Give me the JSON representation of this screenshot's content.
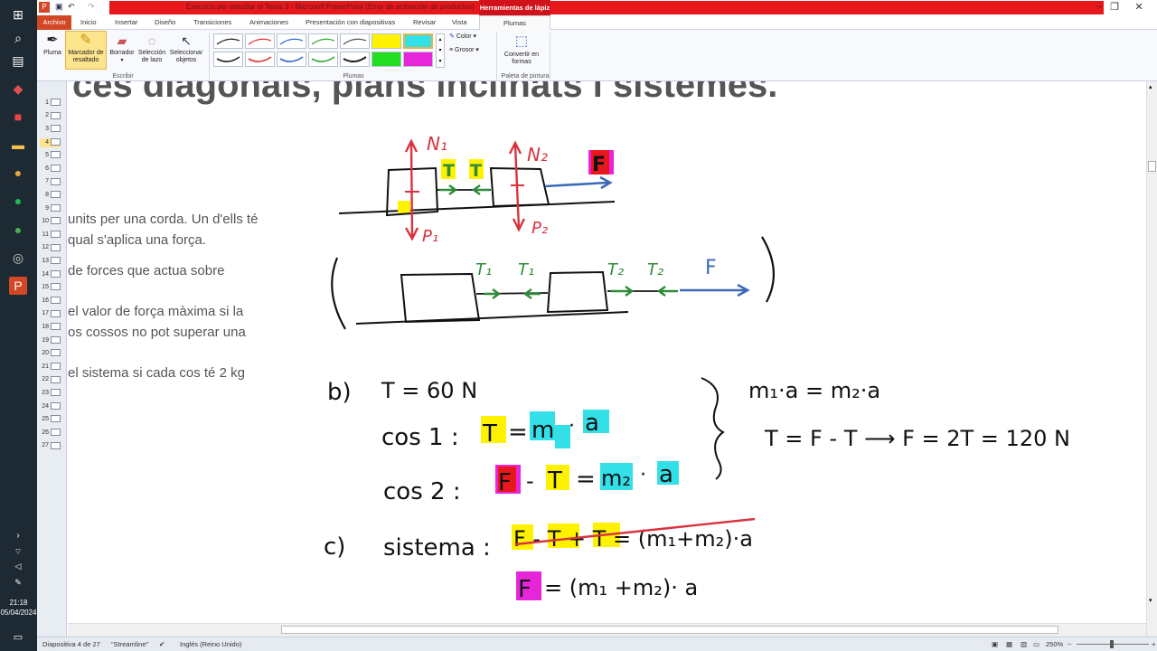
{
  "window": {
    "title": "Exercicis per estudiar el Tema 3 - Microsoft PowerPoint (Error de activación de productos)",
    "context_tab": "Herramientas de lápiz"
  },
  "tabs": [
    "Archivo",
    "Inicio",
    "Insertar",
    "Diseño",
    "Transiciones",
    "Animaciones",
    "Presentación con diapositivas",
    "Revisar",
    "Vista",
    "Plumas"
  ],
  "ribbon": {
    "write_group": "Escribir",
    "pens_group": "Plumas",
    "palette_group": "Paleta de pintura",
    "pen": "Pluma",
    "highlighter": "Marcador de resaltado",
    "eraser": "Borrador",
    "lasso": "Selección de lazo",
    "select_objects": "Seleccionar objetos",
    "color": "Color",
    "weight": "Grosor",
    "convert": "Convertir en formas"
  },
  "thumbs": [
    "1",
    "2",
    "3",
    "4",
    "5",
    "6",
    "7",
    "8",
    "9",
    "10",
    "11",
    "12",
    "13",
    "14",
    "15",
    "16",
    "17",
    "18",
    "19",
    "20",
    "21",
    "22",
    "23",
    "24",
    "25",
    "26",
    "27"
  ],
  "slide": {
    "heading": "ces diagonals, plans inclinats i sistemes.",
    "lines": [
      "units per una corda. Un d'ells té",
      "qual s'aplica una força.",
      "de  forces  que  actua  sobre",
      "el valor de força màxima si la",
      "os cossos no pot superar una",
      "el sistema si cada cos té 2 kg"
    ],
    "ink_text": {
      "n1": "N₁",
      "n2": "N₂",
      "p1": "P₁",
      "p2": "P₂",
      "t": "T",
      "f": "F",
      "t1": "T₁",
      "t2": "T₂",
      "b": "b)",
      "c": "c)",
      "eq1": "T = 60 N",
      "cos1": "cos 1 :",
      "cos2": "cos 2 :",
      "eq_cos1_t": "T",
      "eq_cos1_m": "m",
      "eq_cos1_a": "a",
      "eq_cos2_f": "F",
      "eq_cos2_t": "T",
      "eq_cos2_m": "m₂",
      "eq_cos2_a": "a",
      "right1": "m₁·a = m₂·a",
      "right2": "T = F - T  ⟶  F = 2T = 120 N",
      "sistema": "sistema :",
      "sis_eq": "F - T + T = (m₁+m₂)·a",
      "final_f": "F",
      "final_eq": "= (m₁ +m₂)· a"
    }
  },
  "statusbar": {
    "slide_pos": "Diapositiva 4 de 27",
    "theme": "\"Streamline\"",
    "language": "Inglés (Reino Unido)",
    "zoom": "250%"
  },
  "clock": {
    "time": "21:18",
    "date": "05/04/2024"
  },
  "colors": {
    "red": "#d9333f",
    "green": "#2f8a3a",
    "blue": "#3b6bb5",
    "yellow": "#fff200",
    "cyan": "#33e0e8",
    "magenta": "#e826d9"
  }
}
